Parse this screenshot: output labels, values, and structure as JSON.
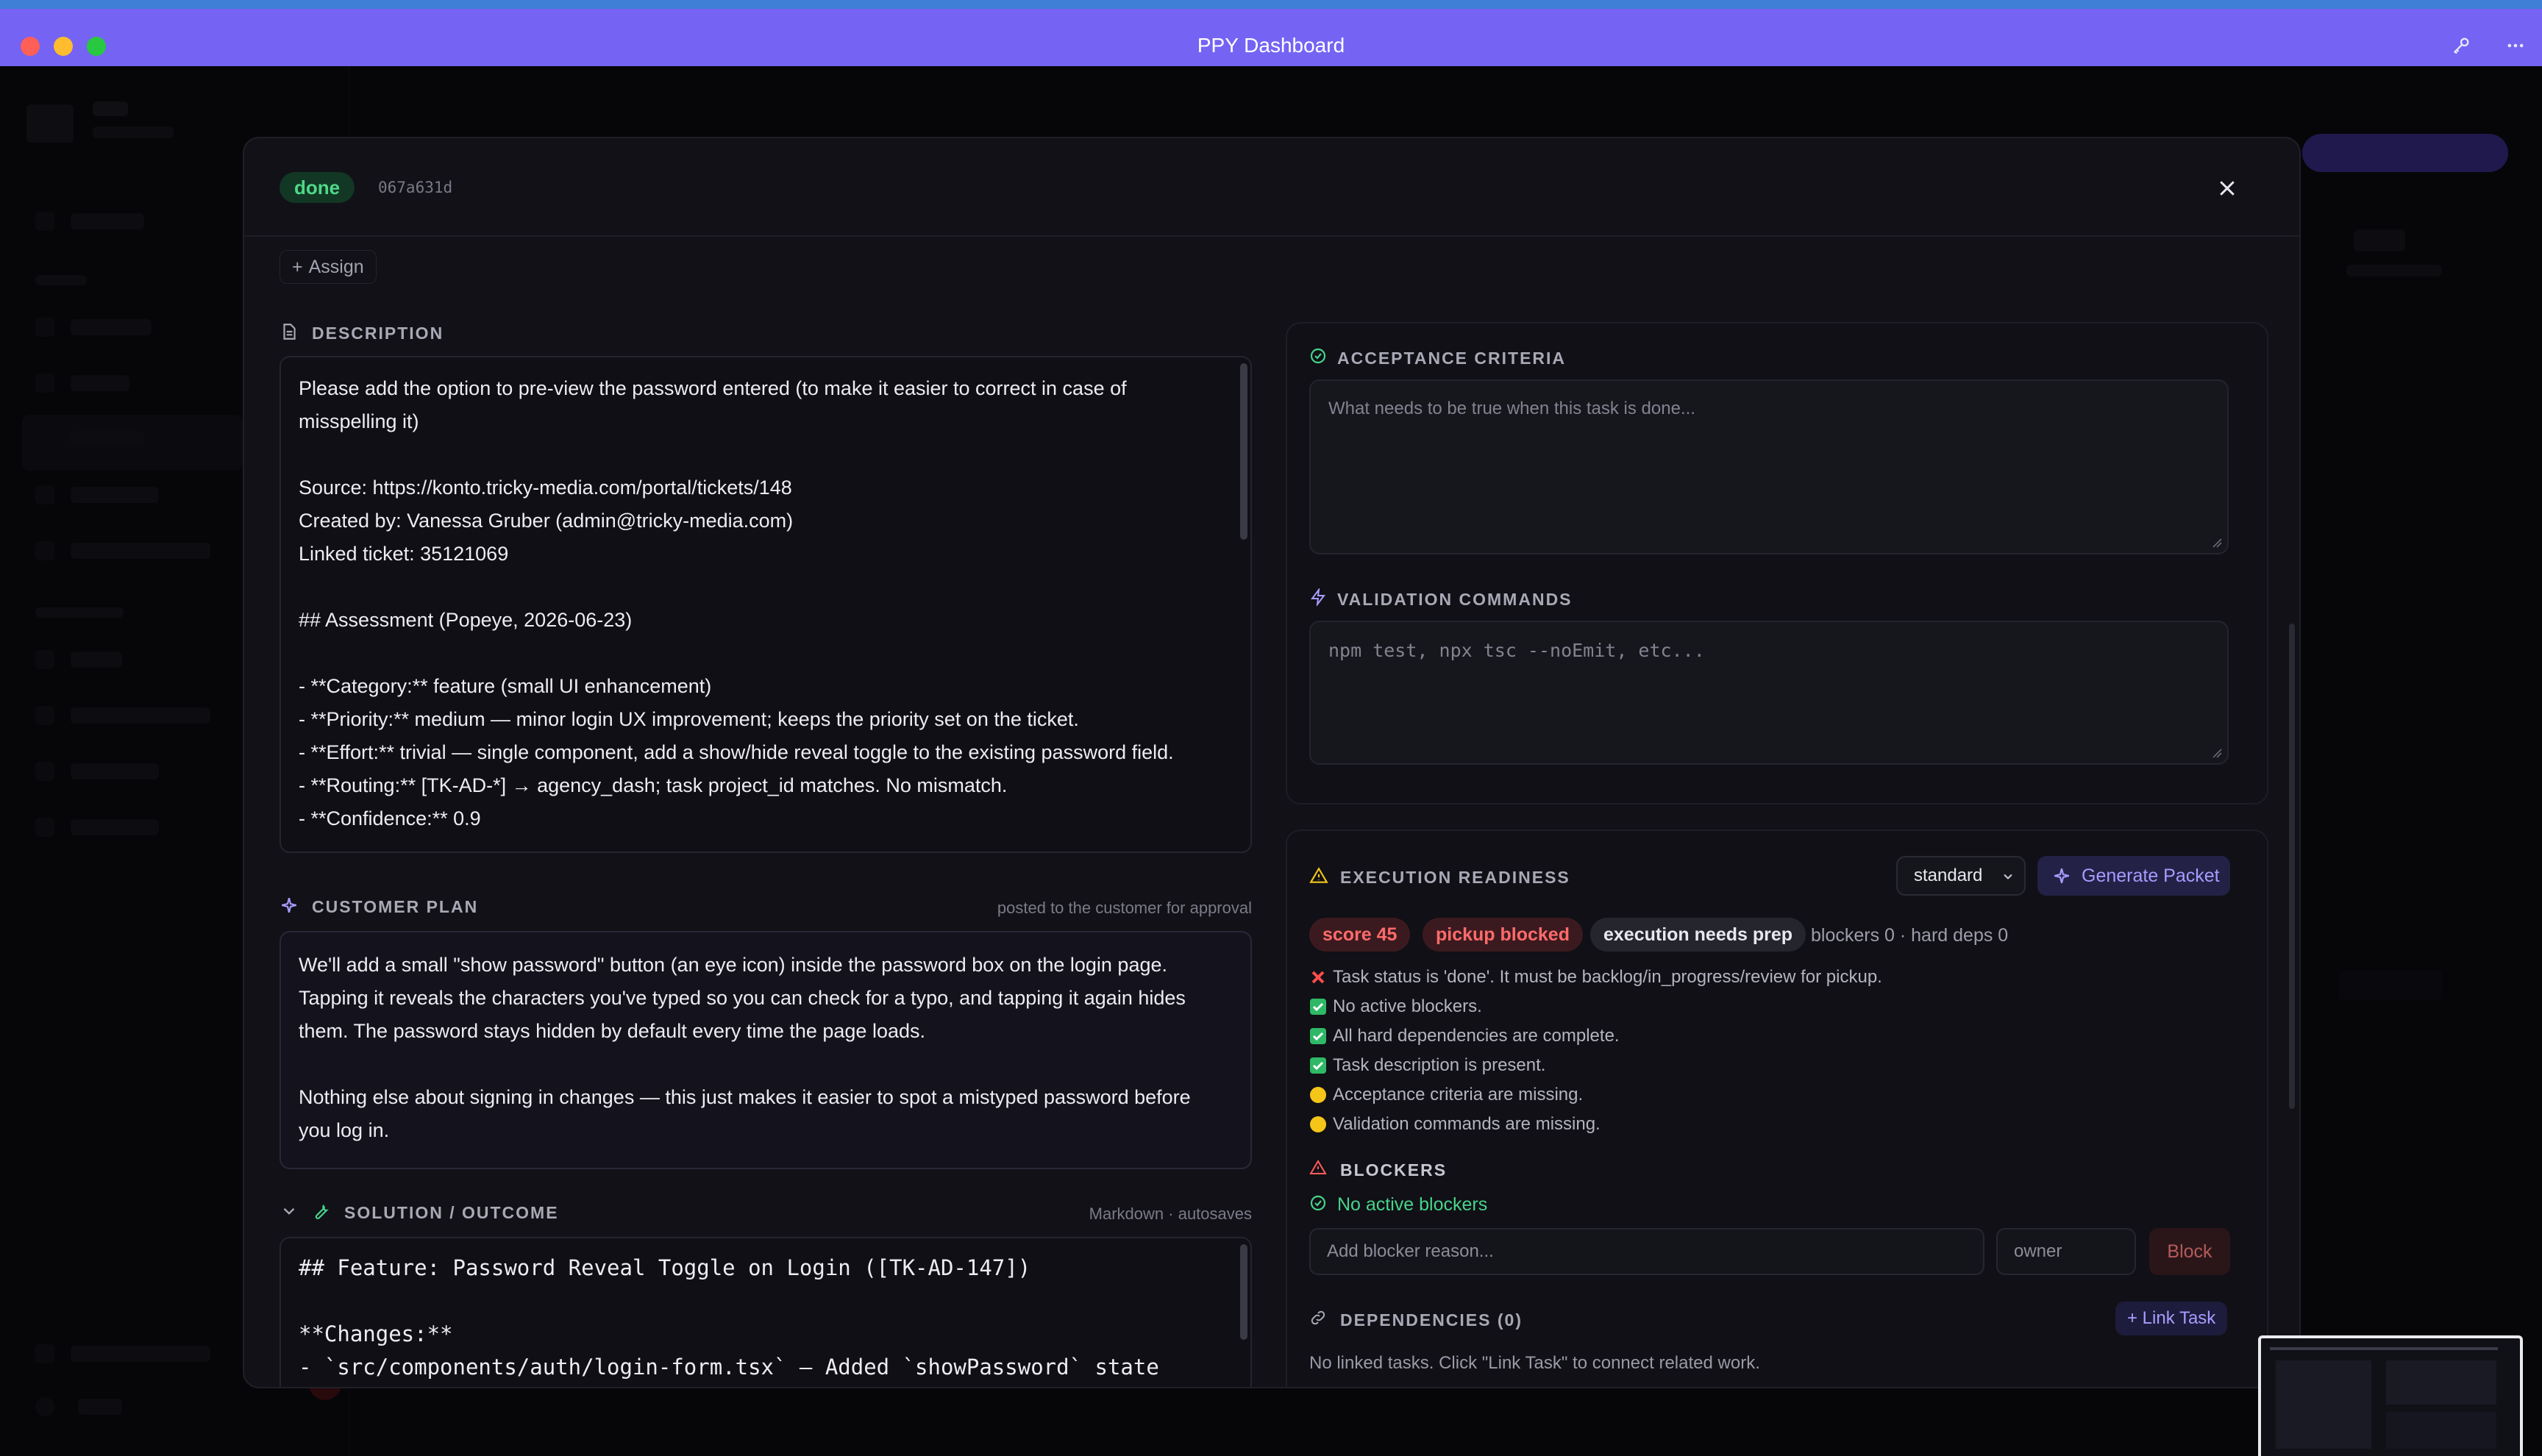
{
  "window": {
    "title": "PPY Dashboard"
  },
  "modal": {
    "status_badge": "done",
    "task_hash": "067a631d",
    "assign_label": "Assign",
    "description": {
      "label": "DESCRIPTION",
      "text": "Please add the option to pre-view the password entered (to make it easier to correct in case of misspelling it)\n\nSource: https://konto.tricky-media.com/portal/tickets/148\nCreated by: Vanessa Gruber (admin@tricky-media.com)\nLinked ticket: 35121069\n\n## Assessment (Popeye, 2026-06-23)\n\n- **Category:** feature (small UI enhancement)\n- **Priority:** medium — minor login UX improvement; keeps the priority set on the ticket.\n- **Effort:** trivial — single component, add a show/hide reveal toggle to the existing password field.\n- **Routing:** [TK-AD-*] → agency_dash; task project_id matches. No mismatch.\n- **Confidence:** 0.9"
    },
    "customer_plan": {
      "label": "CUSTOMER PLAN",
      "note": "posted to the customer for approval",
      "text": "We'll add a small \"show password\" button (an eye icon) inside the password box on the login page. Tapping it reveals the characters you've typed so you can check for a typo, and tapping it again hides them. The password stays hidden by default every time the page loads.\n\nNothing else about signing in changes — this just makes it easier to spot a mistyped password before you log in."
    },
    "solution": {
      "label": "SOLUTION / OUTCOME",
      "note": "Markdown · autosaves",
      "text": "## Feature: Password Reveal Toggle on Login ([TK-AD-147])\n\n**Changes:**\n- `src/components/auth/login-form.tsx` — Added `showPassword` state"
    },
    "acceptance": {
      "label": "ACCEPTANCE CRITERIA",
      "placeholder": "What needs to be true when this task is done..."
    },
    "validation": {
      "label": "VALIDATION COMMANDS",
      "placeholder": "npm test, npx tsc --noEmit, etc..."
    },
    "readiness": {
      "label": "EXECUTION READINESS",
      "mode_selected": "standard",
      "generate_label": "Generate Packet",
      "pills": [
        "score 45",
        "pickup blocked",
        "execution needs prep"
      ],
      "meta": "blockers 0 · hard deps 0",
      "checks": [
        {
          "status": "fail",
          "text": "Task status is 'done'. It must be backlog/in_progress/review for pickup."
        },
        {
          "status": "pass",
          "text": "No active blockers."
        },
        {
          "status": "pass",
          "text": "All hard dependencies are complete."
        },
        {
          "status": "pass",
          "text": "Task description is present."
        },
        {
          "status": "warn",
          "text": "Acceptance criteria are missing."
        },
        {
          "status": "warn",
          "text": "Validation commands are missing."
        }
      ]
    },
    "blockers": {
      "label": "BLOCKERS",
      "status": "No active blockers",
      "reason_placeholder": "Add blocker reason...",
      "owner_placeholder": "owner",
      "block_label": "Block"
    },
    "dependencies": {
      "label": "DEPENDENCIES (0)",
      "link_label": "+ Link Task",
      "empty_text": "No linked tasks. Click \"Link Task\" to connect related work."
    }
  },
  "colors": {
    "titlebar": "#7563f3",
    "accent": "#a79cff",
    "success": "#47d38a",
    "danger": "#ff6b6b",
    "warning": "#f5c518"
  }
}
